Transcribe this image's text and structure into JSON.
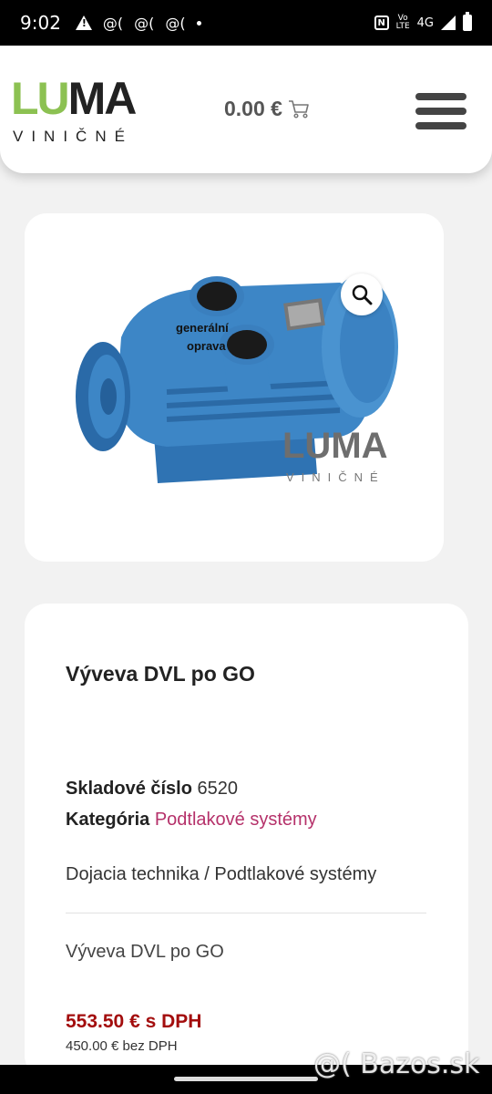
{
  "status_bar": {
    "time": "9:02",
    "notif_icons": [
      "@(",
      "@(",
      "@("
    ],
    "nfc_label": "N",
    "volte_top": "Vo",
    "volte_bottom": "LTE",
    "network": "4G"
  },
  "header": {
    "logo_lu": "LU",
    "logo_ma": "MA",
    "logo_sub": "VINIČNÉ",
    "cart_total": "0.00 €"
  },
  "product_image": {
    "overlay_text_line1": "generální",
    "overlay_text_line2": "oprava",
    "watermark_main": "LUMA",
    "watermark_sub": "VINIČNÉ"
  },
  "product": {
    "title": "Výveva DVL po GO",
    "sku_label": "Skladové číslo",
    "sku_value": "6520",
    "category_label": "Kategória",
    "category_value": "Podtlakové systémy",
    "breadcrumb": "Dojacia technika / Podtlakové systémy",
    "description": "Výveva DVL po GO",
    "price_gross": "553.50 € s DPH",
    "price_net": "450.00 € bez DPH"
  },
  "watermark": "@( Bazos.sk",
  "colors": {
    "brand_green": "#8cc152",
    "price_red": "#a30d0d",
    "link_pink": "#b5316a",
    "pump_blue": "#3d86c6"
  }
}
